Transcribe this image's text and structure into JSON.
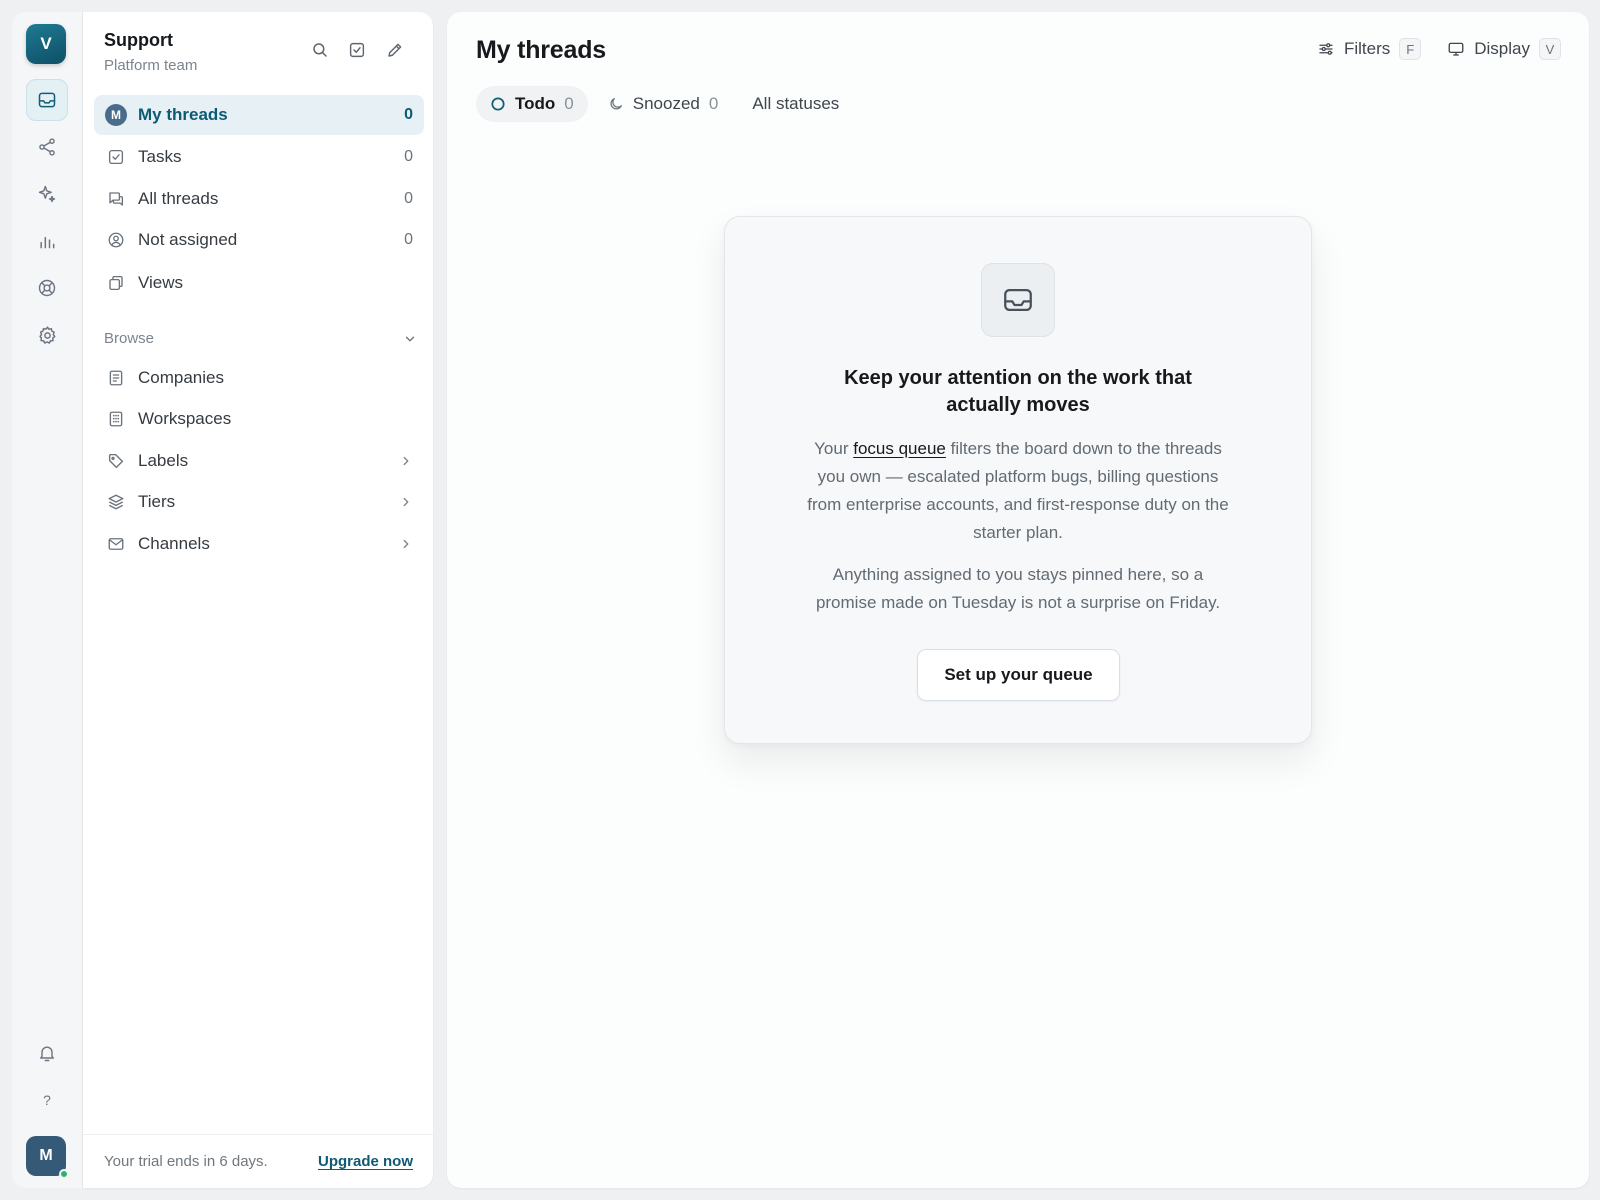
{
  "workspace": {
    "initial": "V",
    "accent": "#125e77"
  },
  "rail": {
    "items": [
      {
        "name": "inbox-icon",
        "active": true
      },
      {
        "name": "share-icon",
        "active": false
      },
      {
        "name": "sparkle-icon",
        "active": false
      },
      {
        "name": "bar-chart-icon",
        "active": false
      },
      {
        "name": "lifebuoy-icon",
        "active": false
      },
      {
        "name": "gear-icon",
        "active": false
      }
    ],
    "help": "?",
    "user_initial": "M"
  },
  "sidebar": {
    "title": "Support",
    "subtitle": "Platform team",
    "nav": [
      {
        "label": "My threads",
        "count": "0",
        "icon": "avatar-m",
        "avatar": "M",
        "active": true
      },
      {
        "label": "Tasks",
        "count": "0",
        "icon": "check-square-icon"
      },
      {
        "label": "All threads",
        "count": "0",
        "icon": "chat-bubbles-icon"
      },
      {
        "label": "Not assigned",
        "count": "0",
        "icon": "user-circle-icon"
      },
      {
        "label": "Views",
        "count": "",
        "icon": "copy-icon"
      }
    ],
    "browse": {
      "heading": "Browse",
      "items": [
        {
          "label": "Companies",
          "icon": "document-icon"
        },
        {
          "label": "Workspaces",
          "icon": "building-icon"
        },
        {
          "label": "Labels",
          "icon": "tag-icon",
          "chevron": true
        },
        {
          "label": "Tiers",
          "icon": "layers-icon",
          "chevron": true
        },
        {
          "label": "Channels",
          "icon": "mail-icon",
          "chevron": true
        }
      ]
    },
    "footer": {
      "trial_text": "Your trial ends in 6 days.",
      "upgrade_label": "Upgrade now"
    }
  },
  "main": {
    "title": "My threads",
    "actions": {
      "filters_label": "Filters",
      "filters_key": "F",
      "display_label": "Display",
      "display_key": "V"
    },
    "tabs": [
      {
        "label": "Todo",
        "count": "0",
        "active": true
      },
      {
        "label": "Snoozed",
        "count": "0"
      },
      {
        "label": "All statuses",
        "count": ""
      }
    ],
    "empty_state": {
      "heading_line1": "Keep your attention on the work that",
      "heading_line2": "actually moves",
      "para1_prefix": "Your ",
      "para1_link": "focus queue",
      "para1_line1_rest": " filters the board down to the threads",
      "para1_line2": "you own — escalated platform bugs, billing questions",
      "para1_line3": "from enterprise accounts, and first-response duty on the",
      "para1_line4": "starter plan.",
      "para2_line1": "Anything assigned to you stays pinned here, so a",
      "para2_line2": "promise made on Tuesday is not a surprise on Friday.",
      "cta_label": "Set up your queue"
    }
  }
}
